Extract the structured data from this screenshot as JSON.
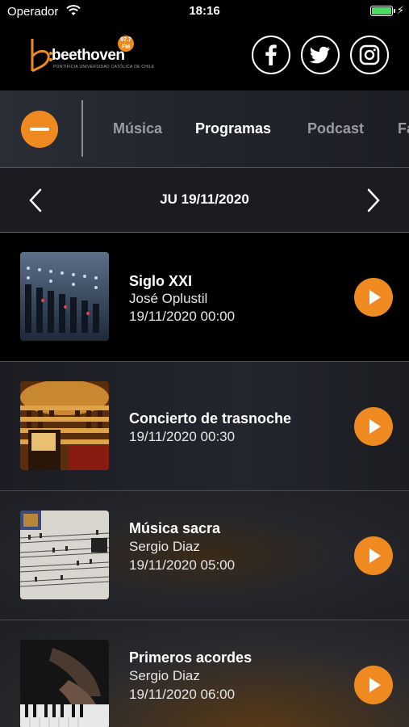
{
  "status_bar": {
    "carrier": "Operador",
    "time": "18:16",
    "battery_color": "#4cd964"
  },
  "header": {
    "logo": {
      "wordmark": "beethoven",
      "frequency": "97.7 FM",
      "tagline": "PONTIFICIA UNIVERSIDAD CATÓLICA DE CHILE"
    },
    "social": [
      {
        "name": "facebook",
        "icon": "facebook-icon"
      },
      {
        "name": "twitter",
        "icon": "twitter-icon"
      },
      {
        "name": "instagram",
        "icon": "instagram-icon"
      }
    ]
  },
  "tabs": [
    {
      "label": "Música",
      "active": false
    },
    {
      "label": "Programas",
      "active": true
    },
    {
      "label": "Podcast",
      "active": false
    },
    {
      "label": "Fa",
      "active": false
    }
  ],
  "date_nav": {
    "label": "JU 19/11/2020",
    "prev_icon": "chevron-left-icon",
    "next_icon": "chevron-right-icon"
  },
  "programs": [
    {
      "title": "Siglo XXI",
      "host": "José Oplustil",
      "datetime": "19/11/2020 00:00",
      "thumb": "mixing-console"
    },
    {
      "title": "Concierto de trasnoche",
      "host": "",
      "datetime": "19/11/2020 00:30",
      "thumb": "opera-house"
    },
    {
      "title": "Música sacra",
      "host": "Sergio Diaz",
      "datetime": "19/11/2020 05:00",
      "thumb": "sheet-music"
    },
    {
      "title": "Primeros acordes",
      "host": "Sergio Diaz",
      "datetime": "19/11/2020 06:00",
      "thumb": "piano-hands"
    }
  ],
  "colors": {
    "accent": "#ee8a1f",
    "background": "#000000",
    "panel": "#23262d"
  }
}
